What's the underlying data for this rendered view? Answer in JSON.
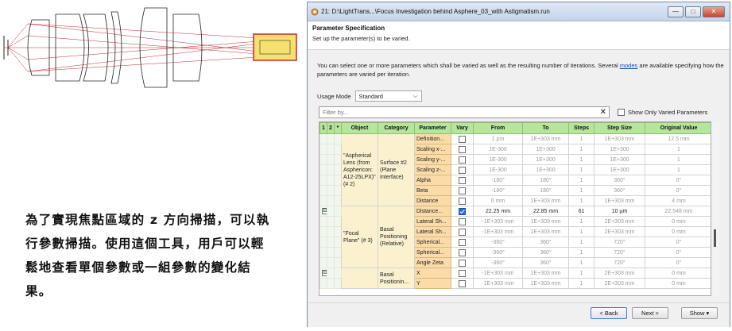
{
  "window": {
    "title": "21: D:\\LightTrans...\\Focus Investigation behind Asphere_03_with Astigmatism.run",
    "minimize": "—",
    "maximize": "□",
    "close": "✕"
  },
  "spec": {
    "heading": "Parameter Specification",
    "subtitle": "Set up the parameter(s) to be varied."
  },
  "description": {
    "before_link": "You can select one or more parameters which shall be varied as well as the resulting number of iterations. Several ",
    "link": "modes",
    "after_link": " are available specifying how the parameters are varied per iteration."
  },
  "usage_mode": {
    "label": "Usage Mode",
    "value": "Standard",
    "arrow": "⌵"
  },
  "filter": {
    "placeholder": "Filter by...",
    "clear": "✕"
  },
  "show_only_varied": {
    "label": "Show Only Varied Parameters",
    "checked": false
  },
  "table": {
    "headers": [
      "1",
      "2",
      "*",
      "Object",
      "Category",
      "Parameter",
      "Vary",
      "From",
      "To",
      "Steps",
      "Step Size",
      "Original Value"
    ],
    "group1": {
      "object": "\"Aspherical Lens (from Asphericon: A12-25LPX)\" (# 2)",
      "category": "Surface #2 (Plane Interface)",
      "rows": [
        {
          "param": "Definition...",
          "vary": false,
          "from": "1 pm",
          "to": "1E+303 mm",
          "steps": "1",
          "stepsize": "1E+303 mm",
          "orig": "12.5 mm"
        },
        {
          "param": "Scaling x-...",
          "vary": false,
          "from": "1E-300",
          "to": "1E+300",
          "steps": "1",
          "stepsize": "1E+300",
          "orig": "1"
        },
        {
          "param": "Scaling y-...",
          "vary": false,
          "from": "1E-300",
          "to": "1E+300",
          "steps": "1",
          "stepsize": "1E+300",
          "orig": "1"
        },
        {
          "param": "Scaling z-...",
          "vary": false,
          "from": "1E-300",
          "to": "1E+300",
          "steps": "1",
          "stepsize": "1E+300",
          "orig": "1"
        },
        {
          "param": "Alpha",
          "vary": false,
          "from": "-180°",
          "to": "180°",
          "steps": "1",
          "stepsize": "360°",
          "orig": "0°"
        },
        {
          "param": "Beta",
          "vary": false,
          "from": "-180°",
          "to": "180°",
          "steps": "1",
          "stepsize": "360°",
          "orig": "0°"
        },
        {
          "param": "Distance",
          "vary": false,
          "from": "0 mm",
          "to": "1E+303 mm",
          "steps": "1",
          "stepsize": "1E+303 mm",
          "orig": "4 mm"
        }
      ]
    },
    "group2": {
      "expander": "⊟",
      "object": "\"Focal Plane\" (# 3)",
      "category": "Basal Positioning (Relative)",
      "rows": [
        {
          "param": "Distance...",
          "vary": true,
          "from": "22.25 mm",
          "to": "22.85 mm",
          "steps": "61",
          "stepsize": "10 µm",
          "orig": "22.548 mm"
        },
        {
          "param": "Lateral Sh...",
          "vary": false,
          "from": "-1E+303 mm",
          "to": "1E+303 mm",
          "steps": "1",
          "stepsize": "2E+303 mm",
          "orig": "0 mm"
        },
        {
          "param": "Lateral Sh...",
          "vary": false,
          "from": "-1E+303 mm",
          "to": "1E+303 mm",
          "steps": "1",
          "stepsize": "2E+303 mm",
          "orig": "0 mm"
        },
        {
          "param": "Spherical...",
          "vary": false,
          "from": "-360°",
          "to": "360°",
          "steps": "1",
          "stepsize": "720°",
          "orig": "0°"
        },
        {
          "param": "Spherical...",
          "vary": false,
          "from": "-360°",
          "to": "360°",
          "steps": "1",
          "stepsize": "720°",
          "orig": "0°"
        },
        {
          "param": "Angle Zeta",
          "vary": false,
          "from": "-360°",
          "to": "360°",
          "steps": "1",
          "stepsize": "720°",
          "orig": "0°"
        }
      ]
    },
    "group3": {
      "expander": "⊟",
      "category": "Basal Positionin...",
      "rows": [
        {
          "param": "X",
          "vary": false,
          "from": "-1E+303 mm",
          "to": "1E+303 mm",
          "steps": "1",
          "stepsize": "2E+303 mm",
          "orig": "0 mm"
        },
        {
          "param": "Y",
          "vary": false,
          "from": "-1E+303 mm",
          "to": "1E+303 mm",
          "steps": "1",
          "stepsize": "2E+303 mm",
          "orig": "0 mm"
        }
      ]
    }
  },
  "buttons": {
    "back": "< Back",
    "next": "Next >",
    "show": "Show ▾"
  },
  "caption": "為了實現焦點區域的 z 方向掃描，可以執行參數掃描。使用這個工具，用戶可以輕鬆地查看單個參數或一組參數的變化結果。",
  "colors": {
    "header_green": "#b7e59c",
    "param_orange": "#fbdca8",
    "object_yellow": "#fbf1cf",
    "lens_red": "#c0282d",
    "detector_yellow": "#f5e070"
  }
}
